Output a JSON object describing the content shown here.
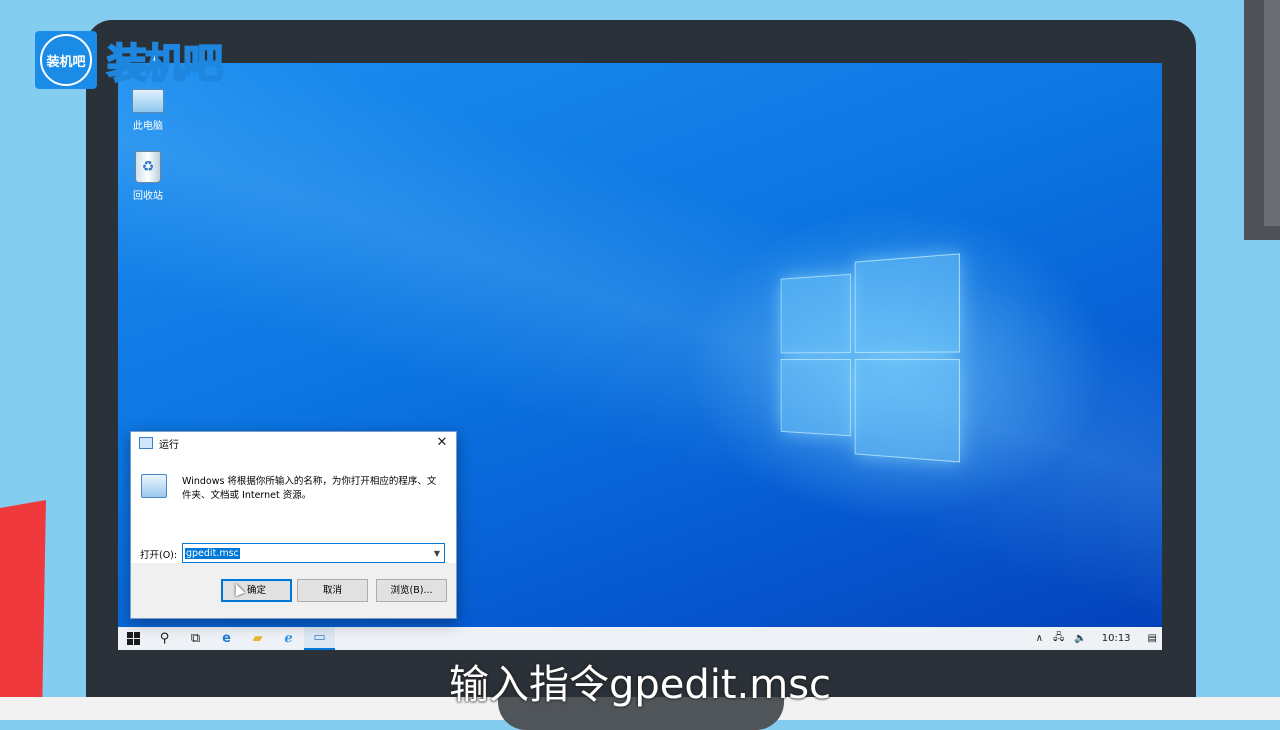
{
  "brand": {
    "badge_text": "装机吧",
    "name": "装机吧"
  },
  "desktop": {
    "icons": [
      {
        "label": "此电脑",
        "icon": "this-pc-icon"
      },
      {
        "label": "回收站",
        "icon": "recycle-bin-icon"
      }
    ]
  },
  "run_dialog": {
    "title": "运行",
    "close_glyph": "✕",
    "description": "Windows 将根据你所输入的名称，为你打开相应的程序、文件夹、文档或 Internet 资源。",
    "open_label": "打开(O):",
    "input_value": "gpedit.msc",
    "ok_label": "确定",
    "cancel_label": "取消",
    "browse_label": "浏览(B)..."
  },
  "taskbar": {
    "items": [
      "start-icon",
      "search-icon",
      "task-view-icon",
      "edge-icon",
      "file-explorer-icon",
      "ie-icon",
      "run-app-icon"
    ],
    "tray": {
      "chevron": "∧",
      "clock": "10:13"
    }
  },
  "subtitle": "输入指令gpedit.msc",
  "colors": {
    "accent": "#0078d7",
    "desktop": "#0b73e0"
  }
}
